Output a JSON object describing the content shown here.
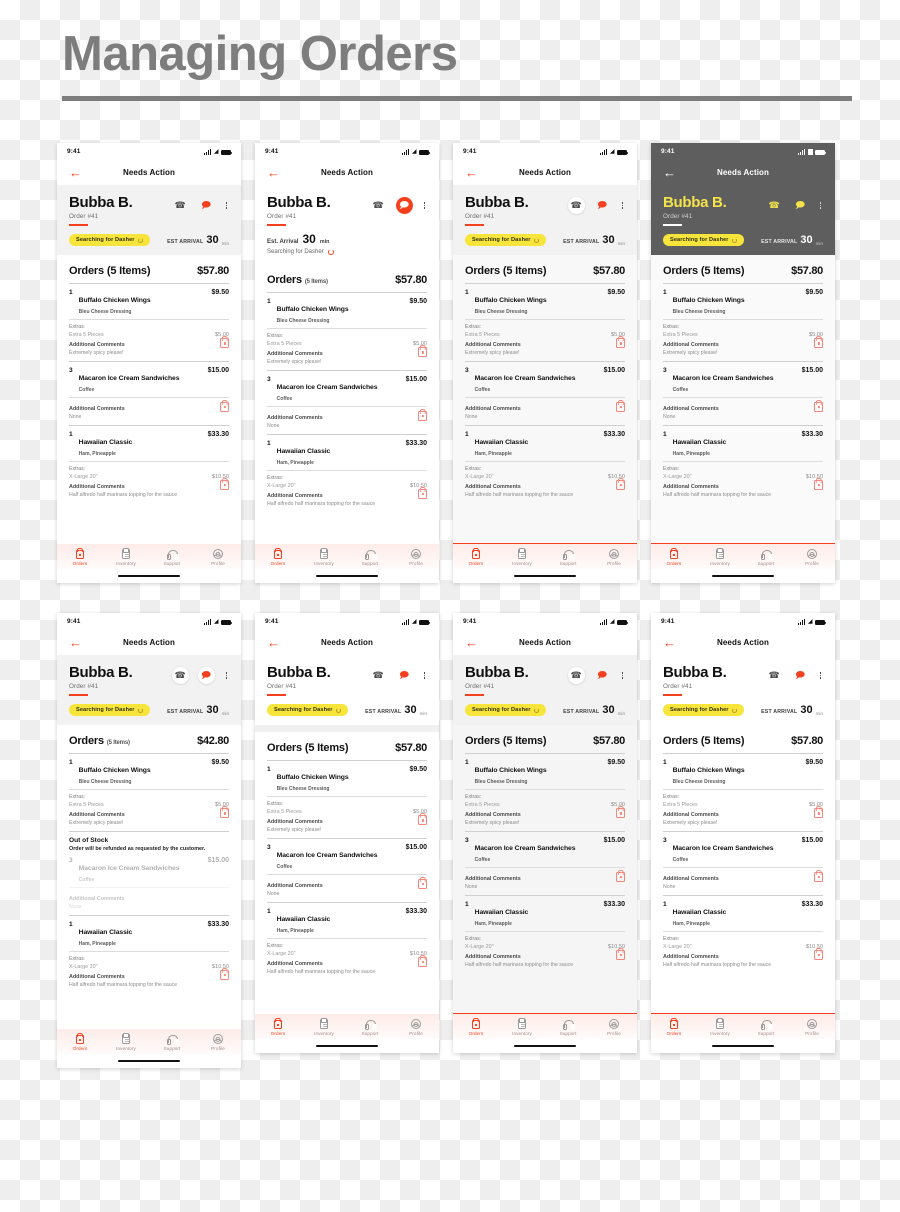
{
  "page": {
    "title": "Managing Orders"
  },
  "status_bar": {
    "time": "9:41",
    "signal_icon": "cellular-signal-icon",
    "wifi_icon": "wifi-icon",
    "battery_icon": "battery-icon"
  },
  "nav": {
    "back_icon": "back-arrow-icon",
    "title": "Needs Action"
  },
  "customer": {
    "name": "Bubba B.",
    "order_id": "Order #41",
    "phone_icon": "phone-icon",
    "chat_icon": "chat-icon",
    "more_icon": "kebab-menu-icon"
  },
  "status": {
    "dasher_badge": "Searching for Dasher",
    "spinner_icon": "loading-spinner-icon",
    "eta_label": "EST ARRIVAL",
    "eta_value": "30",
    "eta_unit": "min",
    "eta_label_alt": "Est. Arrival",
    "eta_unit_alt": "min",
    "searching_text": "Searching for Dasher",
    "badge_color": "#f7e53b",
    "accent_color": "#f4401f"
  },
  "orders": {
    "title": "Orders",
    "count_label": "(5 Items)",
    "total_default": "$57.80",
    "total_refunded": "$42.80",
    "items": [
      {
        "qty": "1",
        "name": "Buffalo Chicken Wings",
        "sub": "Bleu Cheese Dressing",
        "price": "$9.50",
        "extras_label": "Extras:",
        "extras_value": "Extra 5 Pieces",
        "extras_price": "$5.00",
        "comments_label": "Additional Comments",
        "comments_value": "Extremely spicy please!",
        "bag_icon": "shopping-bag-icon"
      },
      {
        "qty": "3",
        "name": "Macaron Ice Cream Sandwiches",
        "sub": "Coffee",
        "price": "$15.00",
        "extras_label": "",
        "extras_value": "",
        "extras_price": "",
        "comments_label": "Additional Comments",
        "comments_value": "None",
        "bag_icon": "shopping-bag-icon"
      },
      {
        "qty": "1",
        "name": "Hawaiian Classic",
        "sub": "Ham, Pineapple",
        "price": "$33.30",
        "extras_label": "Extras:",
        "extras_value": "X-Large 20\"",
        "extras_price": "$10.50",
        "comments_label": "Additional Comments",
        "comments_value": "Half alfredo half marinara topping for the sauce",
        "bag_icon": "shopping-bag-icon"
      }
    ],
    "out_of_stock": {
      "heading": "Out of Stock",
      "note": "Order will be refunded as requested by the customer."
    }
  },
  "tabbar": {
    "tabs": [
      {
        "label": "Orders",
        "icon": "shopping-bag-icon",
        "active": true
      },
      {
        "label": "Inventory",
        "icon": "clipboard-icon",
        "active": false
      },
      {
        "label": "Support",
        "icon": "headset-icon",
        "active": false
      },
      {
        "label": "Profile",
        "icon": "profile-avatar-icon",
        "active": false
      }
    ]
  }
}
